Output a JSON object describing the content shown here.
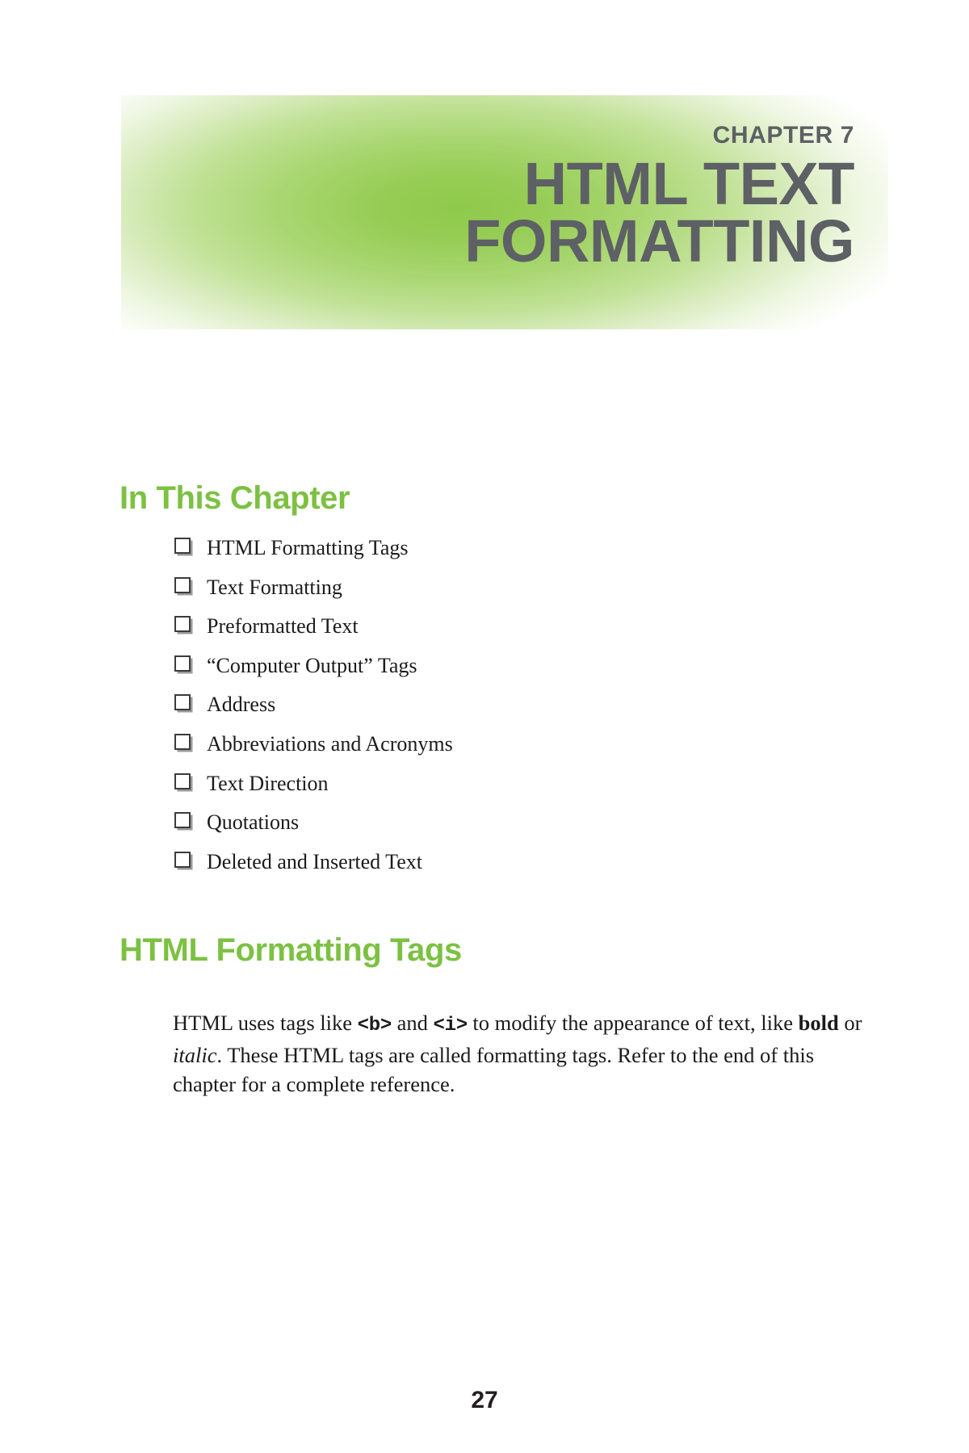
{
  "banner": {
    "eyebrow": "CHAPTER 7",
    "title": "HTML TEXT FORMATTING",
    "accent_color": "#8fc94a",
    "title_color": "#5d6064"
  },
  "sections": {
    "in_this_chapter": {
      "heading": "In This Chapter",
      "heading_color": "#7cc142",
      "items": [
        {
          "label": "HTML Formatting Tags"
        },
        {
          "label": "Text Formatting"
        },
        {
          "label": "Preformatted Text"
        },
        {
          "label": "“Computer Output” Tags"
        },
        {
          "label": "Address"
        },
        {
          "label": "Abbreviations and Acronyms"
        },
        {
          "label": "Text Direction"
        },
        {
          "label": "Quotations"
        },
        {
          "label": "Deleted and Inserted Text"
        }
      ]
    },
    "formatting_tags": {
      "heading": "HTML Formatting Tags",
      "heading_color": "#7cc142",
      "paragraph": {
        "part1": "HTML uses tags like ",
        "code1": "<b>",
        "part2": " and ",
        "code2": "<i>",
        "part3": " to modify the appearance of text, like ",
        "bold_word": "bold",
        "part4": " or ",
        "italic_word": "italic",
        "part5": ". These HTML tags are called formatting tags. Refer to the end of this chapter for a complete reference."
      }
    }
  },
  "footer": {
    "page_number": "27"
  }
}
